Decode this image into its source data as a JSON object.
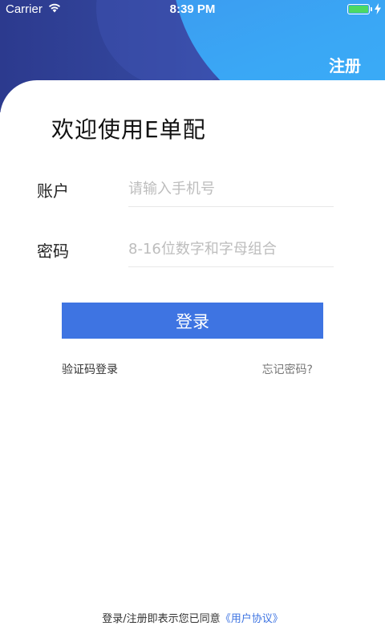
{
  "status_bar": {
    "carrier": "Carrier",
    "time": "8:39 PM",
    "battery_color": "#4cd964"
  },
  "header": {
    "register_label": "注册",
    "colors": {
      "dark": "#2c3a8e",
      "light": "#3aa7f5"
    }
  },
  "welcome": {
    "title": "欢迎使用E单配"
  },
  "form": {
    "account": {
      "label": "账户",
      "placeholder": "请输入手机号",
      "value": ""
    },
    "password": {
      "label": "密码",
      "placeholder": "8-16位数字和字母组合",
      "value": ""
    }
  },
  "login_button": {
    "label": "登录",
    "color": "#3e74e2"
  },
  "links": {
    "sms_login": "验证码登录",
    "forgot_password": "忘记密码?"
  },
  "footer": {
    "agreement_prefix": "登录/注册即表示您已同意",
    "agreement_link": "《用户协议》"
  },
  "icons": [
    "wifi-icon",
    "battery-icon",
    "charging-bolt-icon"
  ]
}
